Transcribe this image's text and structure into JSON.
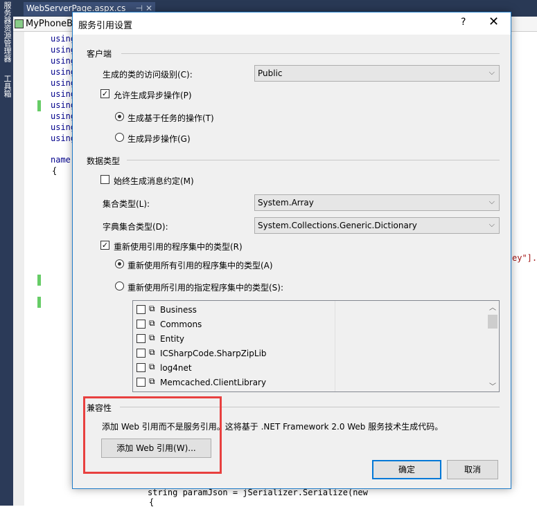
{
  "ide": {
    "sidebar_tabs": [
      "服务器资源管理器",
      "工具箱"
    ],
    "tab_title": "WebServerPage.aspx.cs",
    "nav_dropdown": "MyPhoneBo",
    "code_lines": [
      "using",
      "using",
      "using",
      "using",
      "using",
      "using",
      "using",
      "using",
      "using",
      "using"
    ],
    "namespace_fragment": "name",
    "brace": "{",
    "right_fragment": "ey\"].",
    "bottom_line": "string paramJson = jSerializer.Serialize(new",
    "bottom_brace": "{"
  },
  "dialog": {
    "title": "服务引用设置",
    "help": "?",
    "close": "✕",
    "client": {
      "heading": "客户端",
      "access_label": "生成的类的访问级别(C):",
      "access_value": "Public",
      "async_check": {
        "label": "允许生成异步操作(P)",
        "checked": true
      },
      "radio_task": {
        "label": "生成基于任务的操作(T)",
        "selected": true
      },
      "radio_async": {
        "label": "生成异步操作(G)",
        "selected": false
      }
    },
    "data_type": {
      "heading": "数据类型",
      "msg_contract": {
        "label": "始终生成消息约定(M)",
        "checked": false
      },
      "collection_label": "集合类型(L):",
      "collection_value": "System.Array",
      "dict_label": "字典集合类型(D):",
      "dict_value": "System.Collections.Generic.Dictionary",
      "reuse_check": {
        "label": "重新使用引用的程序集中的类型(R)",
        "checked": true
      },
      "reuse_all": {
        "label": "重新使用所有引用的程序集中的类型(A)",
        "selected": true
      },
      "reuse_specific": {
        "label": "重新使用所引用的指定程序集中的类型(S):",
        "selected": false
      },
      "assemblies": [
        "Business",
        "Commons",
        "Entity",
        "ICSharpCode.SharpZipLib",
        "log4net",
        "Memcached.ClientLibrary"
      ]
    },
    "compat": {
      "heading": "兼容性",
      "desc": "添加 Web 引用而不是服务引用。这将基于 .NET Framework 2.0 Web 服务技术生成代码。",
      "add_web_ref": "添加 Web 引用(W)..."
    },
    "ok": "确定",
    "cancel": "取消",
    "highlight_color": "#e8403f",
    "accent": "#0078d7"
  }
}
